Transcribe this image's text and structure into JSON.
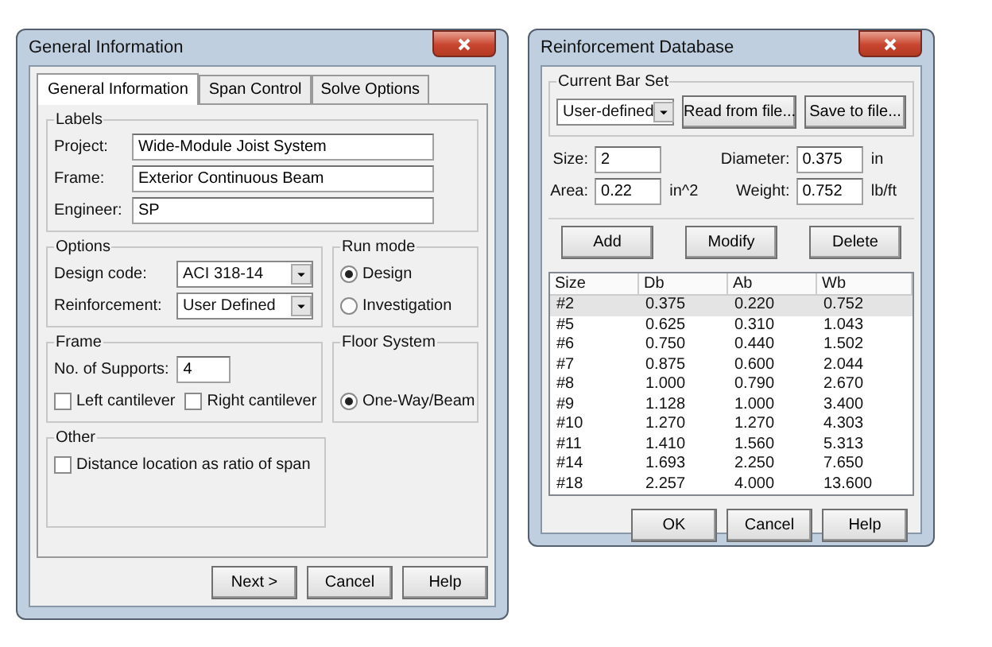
{
  "general_window": {
    "title": "General Information",
    "tabs": [
      {
        "label": "General Information",
        "selected": true
      },
      {
        "label": "Span Control",
        "selected": false
      },
      {
        "label": "Solve Options",
        "selected": false
      }
    ],
    "labels_group": {
      "title": "Labels",
      "fields": [
        {
          "label": "Project:",
          "value": "Wide-Module Joist System"
        },
        {
          "label": "Frame:",
          "value": "Exterior Continuous Beam"
        },
        {
          "label": "Engineer:",
          "value": "SP"
        }
      ]
    },
    "options_group": {
      "title": "Options",
      "dropdowns": [
        {
          "label": "Design code:",
          "value": "ACI 318-14"
        },
        {
          "label": "Reinforcement:",
          "value": "User Defined"
        }
      ]
    },
    "run_mode_group": {
      "title": "Run mode",
      "radios": [
        {
          "label": "Design",
          "selected": true
        },
        {
          "label": "Investigation",
          "selected": false
        }
      ]
    },
    "frame_group": {
      "title": "Frame",
      "supports_label": "No. of Supports:",
      "supports_value": "4",
      "checkboxes": [
        {
          "label": "Left cantilever",
          "checked": false
        },
        {
          "label": "Right cantilever",
          "checked": false
        }
      ]
    },
    "floor_system_group": {
      "title": "Floor System",
      "radios": [
        {
          "label": "One-Way/Beam",
          "selected": true
        }
      ]
    },
    "other_group": {
      "title": "Other",
      "checkboxes": [
        {
          "label": "Distance location as ratio of span",
          "checked": false
        }
      ]
    },
    "buttons": [
      "Next >",
      "Cancel",
      "Help"
    ]
  },
  "reinforcement_window": {
    "title": "Reinforcement Database",
    "current_bar_set": {
      "title": "Current Bar Set",
      "dropdown_value": "User-defined",
      "buttons": [
        "Read from file...",
        "Save to file..."
      ]
    },
    "fields": [
      {
        "label": "Size:",
        "value": "2"
      },
      {
        "label": "Diameter:",
        "value": "0.375",
        "unit": "in"
      },
      {
        "label": "Area:",
        "value": "0.22",
        "unit": "in^2"
      },
      {
        "label": "Weight:",
        "value": "0.752",
        "unit": "lb/ft"
      }
    ],
    "action_buttons": [
      "Add",
      "Modify",
      "Delete"
    ],
    "table": {
      "columns": [
        "Size",
        "Db",
        "Ab",
        "Wb"
      ],
      "rows": [
        {
          "cells": [
            "#2",
            "0.375",
            "0.220",
            "0.752"
          ],
          "selected": true
        },
        {
          "cells": [
            "#5",
            "0.625",
            "0.310",
            "1.043"
          ],
          "selected": false
        },
        {
          "cells": [
            "#6",
            "0.750",
            "0.440",
            "1.502"
          ],
          "selected": false
        },
        {
          "cells": [
            "#7",
            "0.875",
            "0.600",
            "2.044"
          ],
          "selected": false
        },
        {
          "cells": [
            "#8",
            "1.000",
            "0.790",
            "2.670"
          ],
          "selected": false
        },
        {
          "cells": [
            "#9",
            "1.128",
            "1.000",
            "3.400"
          ],
          "selected": false
        },
        {
          "cells": [
            "#10",
            "1.270",
            "1.270",
            "4.303"
          ],
          "selected": false
        },
        {
          "cells": [
            "#11",
            "1.410",
            "1.560",
            "5.313"
          ],
          "selected": false
        },
        {
          "cells": [
            "#14",
            "1.693",
            "2.250",
            "7.650"
          ],
          "selected": false
        },
        {
          "cells": [
            "#18",
            "2.257",
            "4.000",
            "13.600"
          ],
          "selected": false
        }
      ]
    },
    "buttons": [
      "OK",
      "Cancel",
      "Help"
    ]
  }
}
